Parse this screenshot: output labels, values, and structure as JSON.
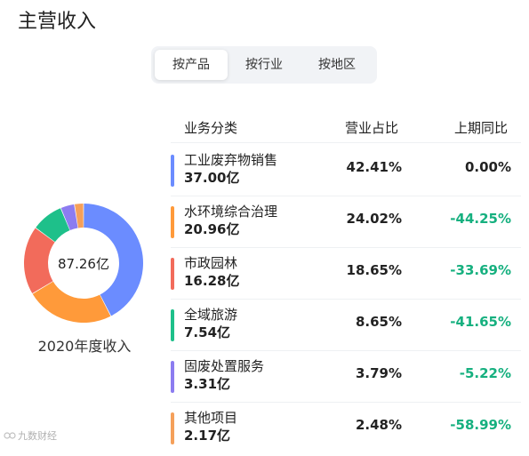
{
  "title": "主营收入",
  "tabs": [
    {
      "label": "按产品",
      "active": true
    },
    {
      "label": "按行业",
      "active": false
    },
    {
      "label": "按地区",
      "active": false
    }
  ],
  "donut": {
    "center_text": "87.26亿",
    "caption": "2020年度收入"
  },
  "table": {
    "headers": [
      "业务分类",
      "营业占比",
      "上期同比"
    ],
    "rows": [
      {
        "name": "工业废弃物销售",
        "amount": "37.00亿",
        "share": "42.41%",
        "change": "0.00%",
        "color": "#6b8cff",
        "change_color": "#222222"
      },
      {
        "name": "水环境综合治理",
        "amount": "20.96亿",
        "share": "24.02%",
        "change": "-44.25%",
        "color": "#ff9a3a",
        "change_color": "#16b07f"
      },
      {
        "name": "市政园林",
        "amount": "16.28亿",
        "share": "18.65%",
        "change": "-33.69%",
        "color": "#f26b5b",
        "change_color": "#16b07f"
      },
      {
        "name": "全域旅游",
        "amount": "7.54亿",
        "share": "8.65%",
        "change": "-41.65%",
        "color": "#1ec08a",
        "change_color": "#16b07f"
      },
      {
        "name": "固废处置服务",
        "amount": "3.31亿",
        "share": "3.79%",
        "change": "-5.22%",
        "color": "#8c7cf0",
        "change_color": "#16b07f"
      },
      {
        "name": "其他项目",
        "amount": "2.17亿",
        "share": "2.48%",
        "change": "-58.99%",
        "color": "#f5a05a",
        "change_color": "#16b07f"
      }
    ]
  },
  "watermark": "九数财经"
}
